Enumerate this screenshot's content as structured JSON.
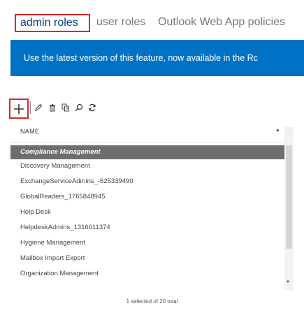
{
  "tabs": [
    {
      "label": "admin roles",
      "active": true
    },
    {
      "label": "user roles",
      "active": false
    },
    {
      "label": "Outlook Web App policies",
      "active": false
    }
  ],
  "banner": {
    "text": "Use the latest version of this feature, now available in the Rc"
  },
  "toolbar": {
    "icons": [
      "add-icon",
      "edit-icon",
      "delete-icon",
      "copy-icon",
      "search-icon",
      "refresh-icon"
    ],
    "accent_color": "#0072c6",
    "highlight_color": "#d9262e"
  },
  "table": {
    "column_header": "NAME",
    "sort": "ascending",
    "rows": [
      {
        "name": "Compliance Management",
        "selected": true
      },
      {
        "name": "Discovery Management",
        "selected": false
      },
      {
        "name": "ExchangeServiceAdmins_-625339490",
        "selected": false
      },
      {
        "name": "GlobalReaders_1765848945",
        "selected": false
      },
      {
        "name": "Help Desk",
        "selected": false
      },
      {
        "name": "HelpdeskAdmins_1316011374",
        "selected": false
      },
      {
        "name": "Hygiene Management",
        "selected": false
      },
      {
        "name": "Mailbox Import Export",
        "selected": false
      },
      {
        "name": "Organization Management",
        "selected": false
      }
    ]
  },
  "footer": {
    "status": "1 selected of 20 total"
  }
}
